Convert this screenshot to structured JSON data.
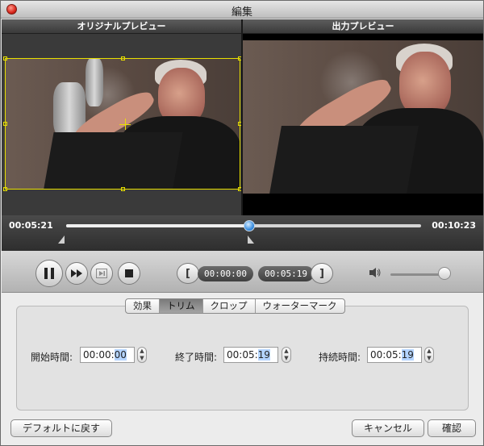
{
  "window": {
    "title": "編集"
  },
  "preview": {
    "original_label": "オリジナルプレビュー",
    "output_label": "出力プレビュー"
  },
  "timeline": {
    "current_time": "00:05:21",
    "total_time": "00:10:23",
    "progress": 0.516,
    "start_marker": 0.0,
    "end_marker": 0.512
  },
  "controls": {
    "pause_icon": "pause-icon",
    "fast_forward_icon": "fast-forward-icon",
    "frame_step_icon": "frame-step-icon",
    "stop_icon": "stop-icon",
    "start_bracket": "[",
    "start_time": "00:00:00",
    "end_time": "00:05:19",
    "end_bracket": "]",
    "volume_icon": "speaker-icon",
    "volume_level": 0.85
  },
  "tabs": [
    {
      "label": "効果",
      "active": false
    },
    {
      "label": "トリム",
      "active": true
    },
    {
      "label": "クロップ",
      "active": false
    },
    {
      "label": "ウォーターマーク",
      "active": false
    }
  ],
  "trim": {
    "start_label": "開始時間:",
    "start_value_main": "00:00:",
    "start_value_sel": "00",
    "end_label": "終了時間:",
    "end_value_main": "00:05:",
    "end_value_sel": "19",
    "duration_label": "持続時間:",
    "duration_value_main": "00:05:",
    "duration_value_sel": "19"
  },
  "buttons": {
    "reset_label": "デフォルトに戻す",
    "cancel_label": "キャンセル",
    "confirm_label": "確認"
  },
  "colors": {
    "crop_box": "#e8e000",
    "playhead": "#3a8ee0",
    "close_button": "#d9261c"
  }
}
